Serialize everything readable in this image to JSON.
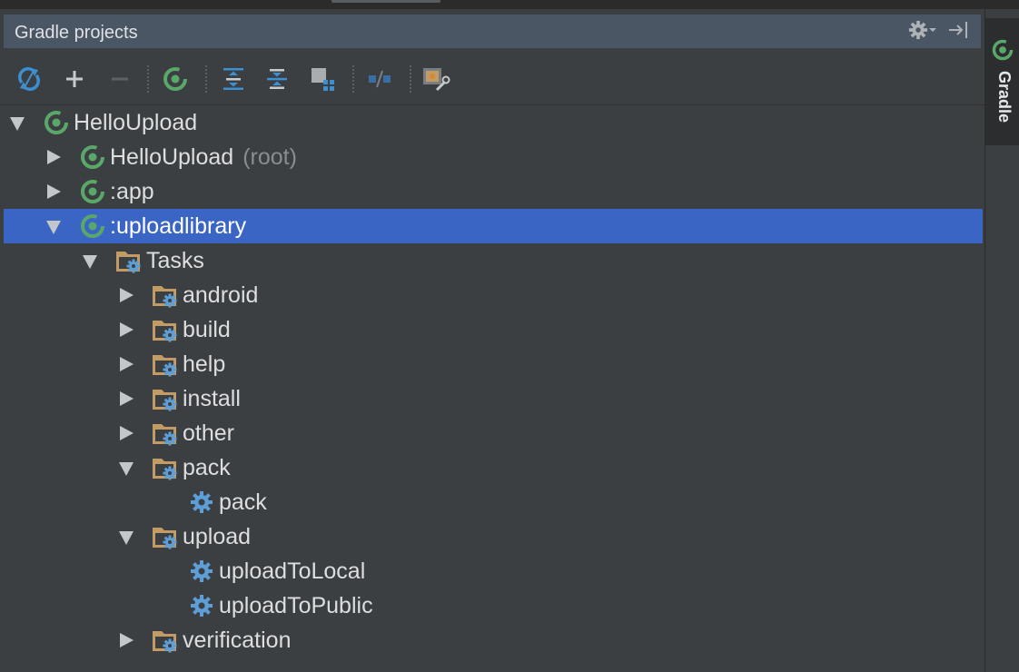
{
  "panel": {
    "title": "Gradle projects"
  },
  "toolbar": {
    "tools": [
      {
        "name": "refresh-icon"
      },
      {
        "name": "add-icon"
      },
      {
        "name": "remove-icon"
      },
      {
        "name": "gradle-execute-icon"
      },
      {
        "name": "expand-all-icon"
      },
      {
        "name": "collapse-all-icon"
      },
      {
        "name": "group-modules-icon"
      },
      {
        "name": "toggle-offline-icon"
      },
      {
        "name": "gradle-settings-icon"
      }
    ]
  },
  "tree": {
    "rows": [
      {
        "label": "HelloUpload",
        "suffix": "",
        "level": 0,
        "expander": "down",
        "icon": "gradle",
        "selected": false
      },
      {
        "label": "HelloUpload",
        "suffix": "(root)",
        "level": 1,
        "expander": "right",
        "icon": "gradle",
        "selected": false
      },
      {
        "label": ":app",
        "suffix": "",
        "level": 1,
        "expander": "right",
        "icon": "gradle",
        "selected": false
      },
      {
        "label": ":uploadlibrary",
        "suffix": "",
        "level": 1,
        "expander": "down",
        "icon": "gradle",
        "selected": true
      },
      {
        "label": "Tasks",
        "suffix": "",
        "level": 2,
        "expander": "down",
        "icon": "folder",
        "selected": false
      },
      {
        "label": "android",
        "suffix": "",
        "level": 3,
        "expander": "right",
        "icon": "folder",
        "selected": false
      },
      {
        "label": "build",
        "suffix": "",
        "level": 3,
        "expander": "right",
        "icon": "folder",
        "selected": false
      },
      {
        "label": "help",
        "suffix": "",
        "level": 3,
        "expander": "right",
        "icon": "folder",
        "selected": false
      },
      {
        "label": "install",
        "suffix": "",
        "level": 3,
        "expander": "right",
        "icon": "folder",
        "selected": false
      },
      {
        "label": "other",
        "suffix": "",
        "level": 3,
        "expander": "right",
        "icon": "folder",
        "selected": false
      },
      {
        "label": "pack",
        "suffix": "",
        "level": 3,
        "expander": "down",
        "icon": "folder",
        "selected": false
      },
      {
        "label": "pack",
        "suffix": "",
        "level": 4,
        "expander": "none",
        "icon": "task",
        "selected": false
      },
      {
        "label": "upload",
        "suffix": "",
        "level": 3,
        "expander": "down",
        "icon": "folder",
        "selected": false
      },
      {
        "label": "uploadToLocal",
        "suffix": "",
        "level": 4,
        "expander": "none",
        "icon": "task",
        "selected": false
      },
      {
        "label": "uploadToPublic",
        "suffix": "",
        "level": 4,
        "expander": "none",
        "icon": "task",
        "selected": false
      },
      {
        "label": "verification",
        "suffix": "",
        "level": 3,
        "expander": "right",
        "icon": "folder",
        "selected": false
      }
    ]
  },
  "side_stripe": {
    "tab_label": "Gradle"
  },
  "colors": {
    "selection": "#3b65c5",
    "gradle_green": "#59a869",
    "folder": "#c29b66",
    "task_gear": "#5e9ed6"
  }
}
